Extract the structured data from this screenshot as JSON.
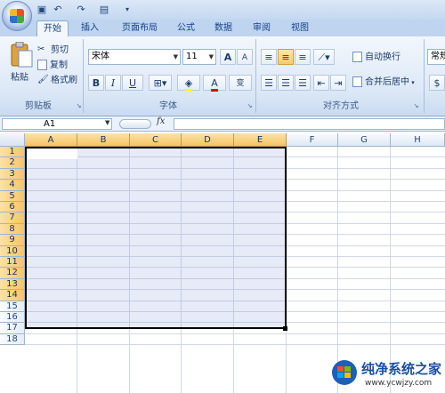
{
  "quick_access": {
    "save_icon": "save-icon",
    "undo_icon": "undo-icon",
    "redo_icon": "redo-icon",
    "preview_icon": "print-preview-icon",
    "customize_icon": "customize-icon"
  },
  "tabs": [
    {
      "label": "开始",
      "active": true
    },
    {
      "label": "插入"
    },
    {
      "label": "页面布局"
    },
    {
      "label": "公式"
    },
    {
      "label": "数据"
    },
    {
      "label": "审阅"
    },
    {
      "label": "视图"
    }
  ],
  "clipboard": {
    "paste": "粘贴",
    "cut": "剪切",
    "copy": "复制",
    "format_painter": "格式刷",
    "group": "剪贴板"
  },
  "font": {
    "name": "宋体",
    "size": "11",
    "grow": "A",
    "shrink": "A",
    "bold": "B",
    "italic": "I",
    "underline": "U",
    "color_letter": "A",
    "phonetic": "变",
    "group": "字体"
  },
  "alignment": {
    "wrap": "自动换行",
    "merge": "合并后居中",
    "group": "对齐方式"
  },
  "number": {
    "format": "常规"
  },
  "formula_bar": {
    "name_box": "A1",
    "fx": "fx",
    "formula": ""
  },
  "columns": [
    "A",
    "B",
    "C",
    "D",
    "E",
    "F",
    "G",
    "H"
  ],
  "rows": [
    "1",
    "2",
    "3",
    "4",
    "5",
    "6",
    "7",
    "8",
    "9",
    "10",
    "11",
    "12",
    "13",
    "14",
    "15",
    "16",
    "17",
    "18"
  ],
  "selection": {
    "range": "A1:E14"
  },
  "watermark": {
    "brand": "纯净系统之家",
    "url": "www.ycwjzy.com"
  },
  "colors": {
    "ribbon_bg": "#dce8f6",
    "header_selected": "#f6c467",
    "selection_fill": "#e3e6f6",
    "grid_line": "#d0d7e5"
  }
}
